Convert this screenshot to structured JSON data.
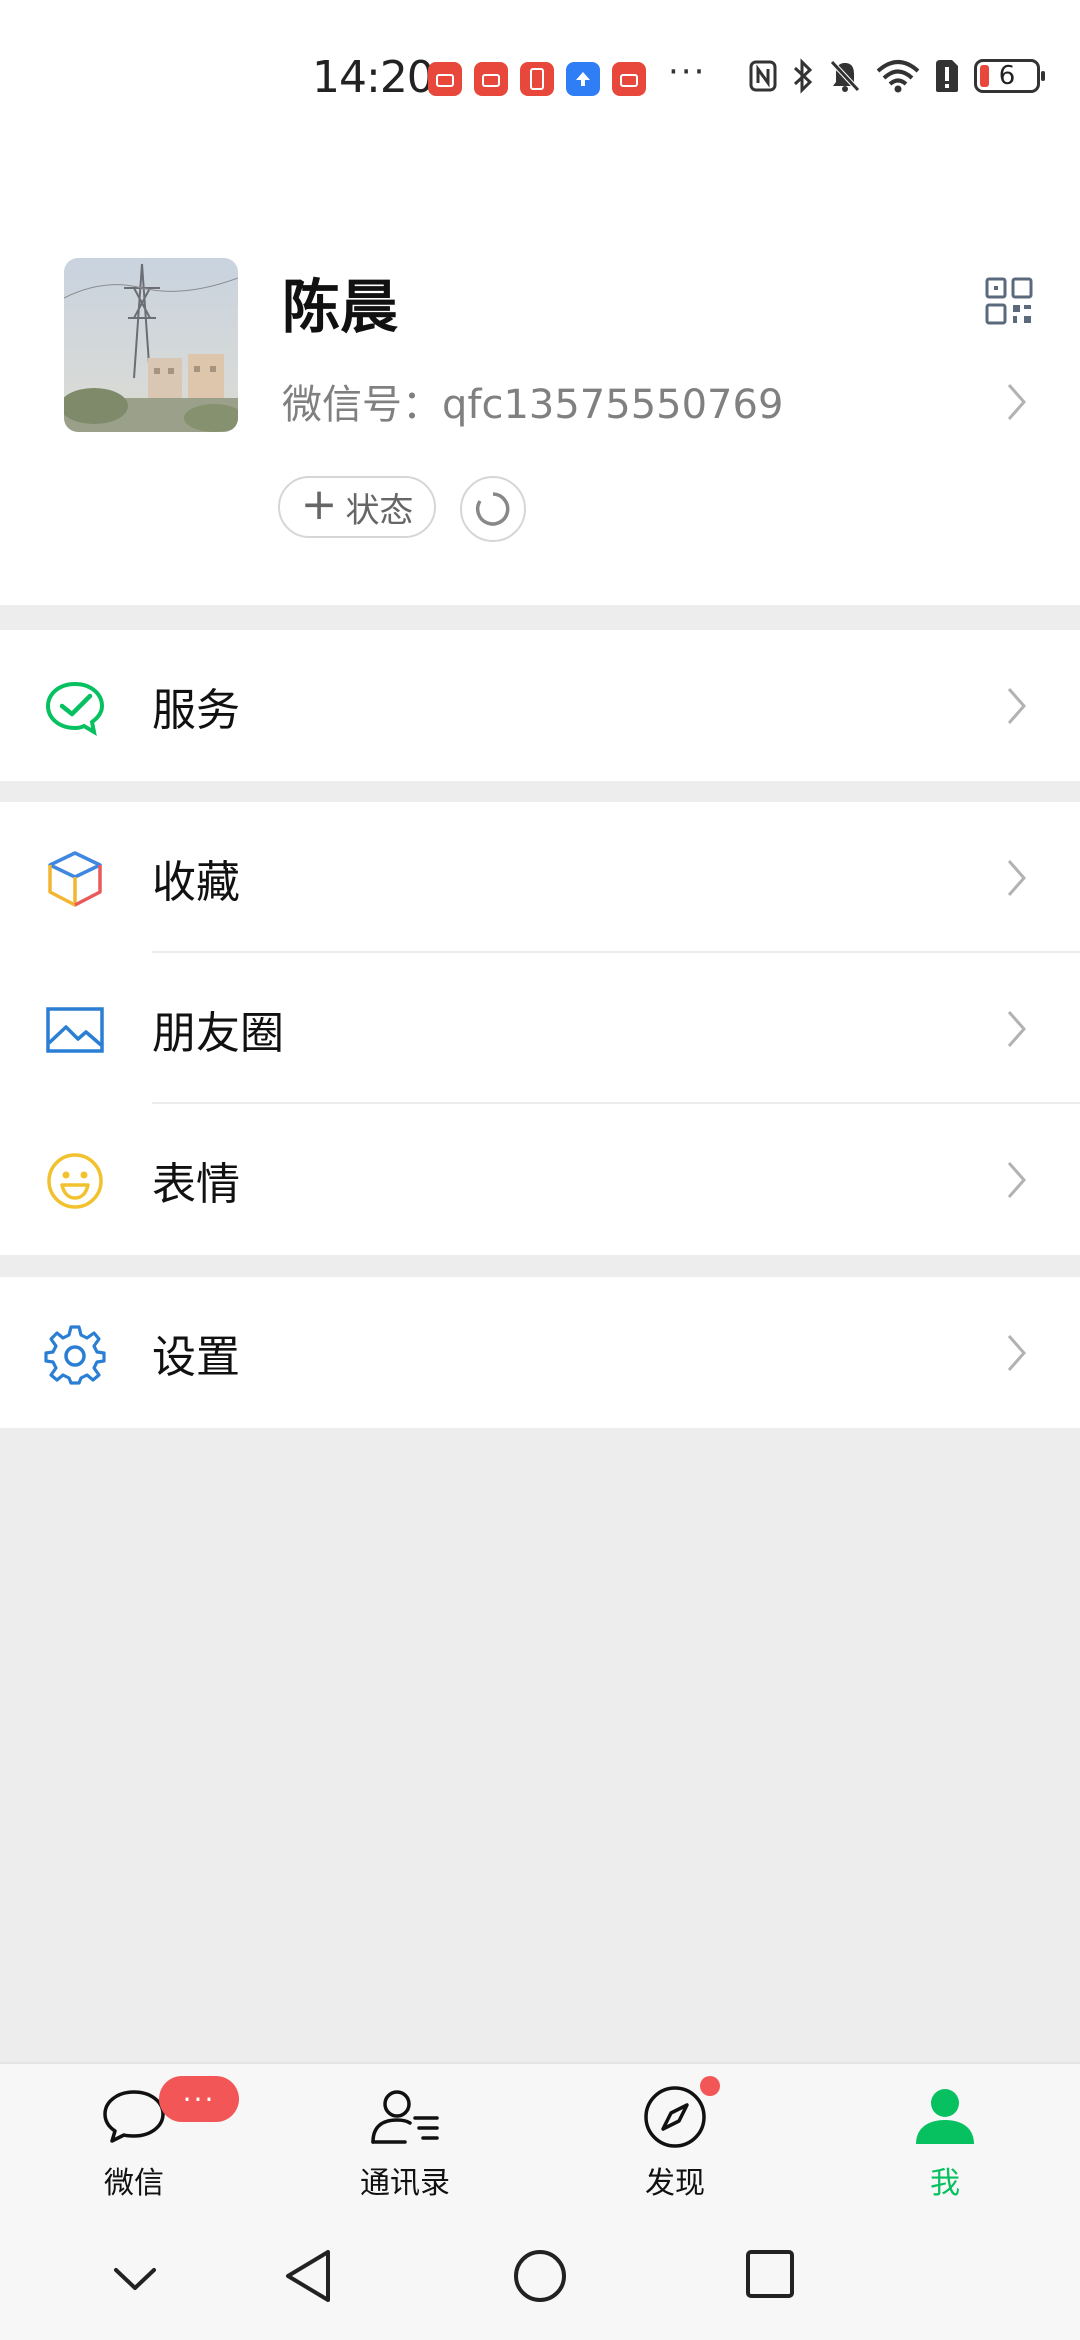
{
  "status_bar": {
    "time": "14:20",
    "battery_level": "6",
    "notification_icons": [
      "huawei-store-icon",
      "huawei-store-icon",
      "phone-manager-icon",
      "upload-icon",
      "huawei-store-icon"
    ],
    "more": "···"
  },
  "profile": {
    "name": "陈晨",
    "wechat_id": "微信号：qfc13575550769",
    "status_button": "状态"
  },
  "menu": {
    "services": "服务",
    "favorites": "收藏",
    "moments": "朋友圈",
    "stickers": "表情",
    "settings": "设置"
  },
  "tabbar": {
    "chats": "微信",
    "contacts": "通讯录",
    "discover": "发现",
    "me": "我",
    "chats_badge": "···"
  },
  "colors": {
    "accent_green": "#07c160",
    "badge_red": "#f25656",
    "background": "#ededed"
  }
}
